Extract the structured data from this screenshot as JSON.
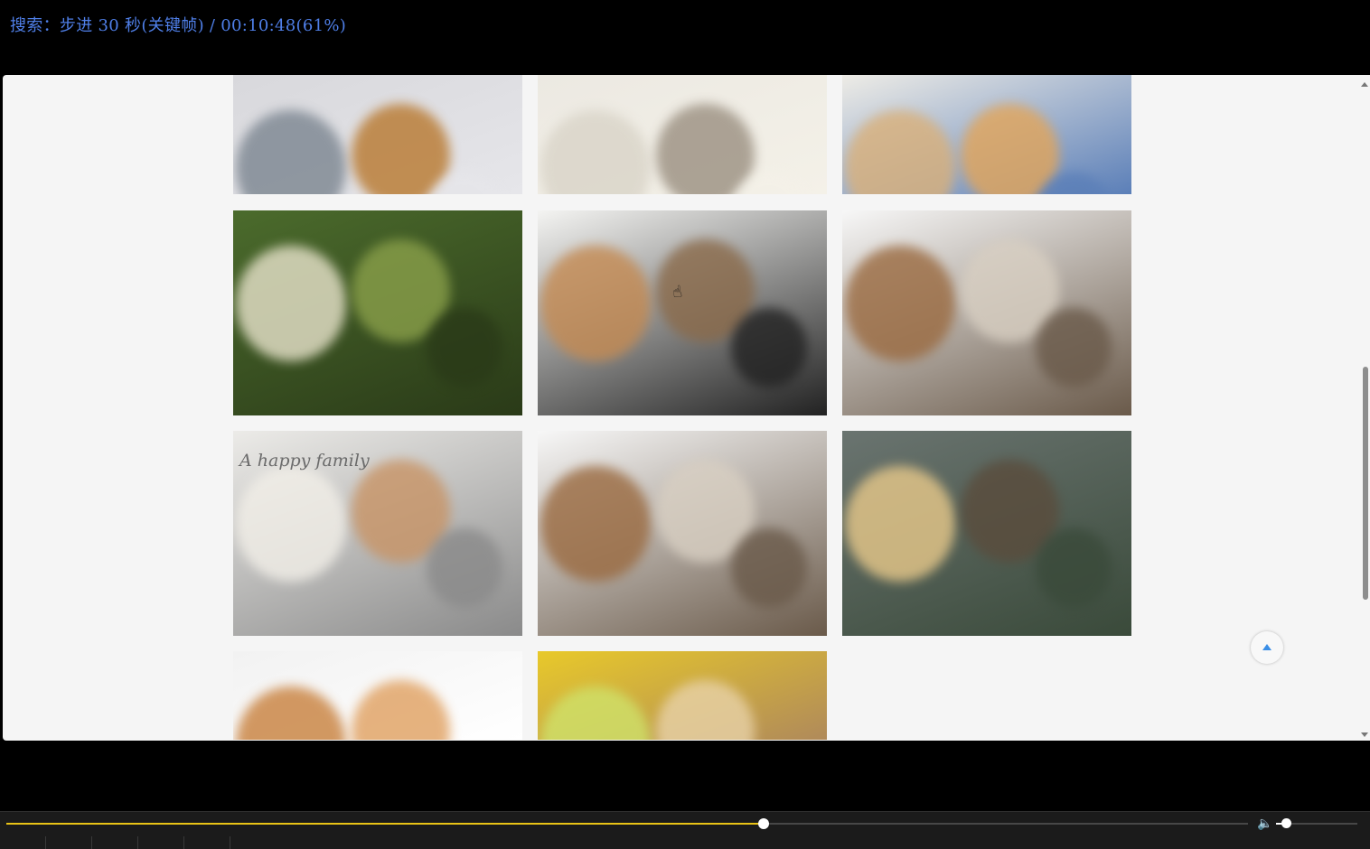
{
  "osd": {
    "text": "搜索：步进 30 秒(关键帧) / 00:10:48(61%)"
  },
  "playback": {
    "progress_fraction": 0.61,
    "volume_fraction": 0.12
  },
  "images": [
    {
      "name": "cat-and-golden-dog-eating",
      "bg": "#d8d8dc",
      "colors": [
        "#7b8590",
        "#b8782e",
        "#e6e6ea"
      ]
    },
    {
      "name": "dog-and-cat-under-blanket",
      "bg": "#ece9e2",
      "colors": [
        "#d9d4c8",
        "#9a8f80",
        "#f4f1e8"
      ]
    },
    {
      "name": "spaniel-and-kitten-vet",
      "bg": "#eeece6",
      "colors": [
        "#d9b07a",
        "#e2a55a",
        "#5b7fb8"
      ]
    },
    {
      "name": "golden-retriever-portrait",
      "bg": "#4b6b2c",
      "colors": [
        "#e9e4cc",
        "#8aa04a",
        "#2a3a18"
      ]
    },
    {
      "name": "puppies-and-kittens-collage",
      "bg": "#f4f4f2",
      "colors": [
        "#c48a52",
        "#8a6a4a",
        "#222222"
      ]
    },
    {
      "name": "dogs-and-cats-row",
      "bg": "#f7f7f7",
      "colors": [
        "#9a6a40",
        "#d8cfc2",
        "#6a5a4a"
      ]
    },
    {
      "name": "shih-tzu-happy-family",
      "bg": "#ecebe8",
      "colors": [
        "#f2efe8",
        "#c89466",
        "#8a8a8a"
      ]
    },
    {
      "name": "dogs-and-cats-row-2",
      "bg": "#f7f7f7",
      "colors": [
        "#9a6a40",
        "#d8cfc2",
        "#6a5a4a"
      ]
    },
    {
      "name": "fluffy-dog-and-cat-living-room",
      "bg": "#6a7470",
      "colors": [
        "#e8c98a",
        "#5a4c3c",
        "#3a4a3a"
      ]
    },
    {
      "name": "poodle-puppy",
      "bg": "#f2f2f2",
      "colors": [
        "#c8803c",
        "#e0a060",
        "#ffffff"
      ]
    },
    {
      "name": "golden-puppies-yellow",
      "bg": "#e8c92a",
      "colors": [
        "#cfe26a",
        "#e8d2a8",
        "#b08a5a"
      ]
    }
  ],
  "watermark_text": "A happy family"
}
